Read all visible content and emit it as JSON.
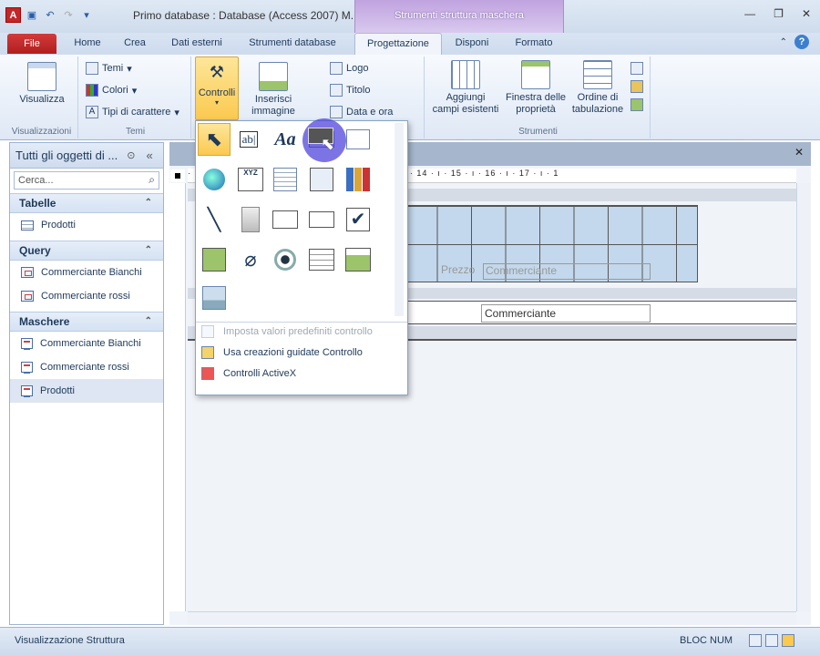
{
  "window": {
    "title": "Primo database : Database (Access 2007) M...",
    "context_tab": "Strumenti struttura maschera"
  },
  "tabs": [
    "File",
    "Home",
    "Crea",
    "Dati esterni",
    "Strumenti database",
    "Progettazione",
    "Disponi",
    "Formato"
  ],
  "ribbon": {
    "visualizza": "Visualizza",
    "visualizzazioni": "Visualizzazioni",
    "temi": "Temi",
    "colori": "Colori",
    "tipi_carattere": "Tipi di carattere",
    "temi_group": "Temi",
    "controlli": "Controlli",
    "inserisci": "Inserisci",
    "immagine": "immagine",
    "logo": "Logo",
    "titolo": "Titolo",
    "data_ora": "Data e ora",
    "intest_partial": "ina",
    "aggiungi": "Aggiungi",
    "campi_esistenti": "campi esistenti",
    "finestra": "Finestra delle",
    "proprieta": "proprietà",
    "ordine": "Ordine di",
    "tabulazione": "tabulazione",
    "strumenti": "Strumenti"
  },
  "nav": {
    "header": "Tutti gli oggetti di ...",
    "search_placeholder": "Cerca...",
    "sections": [
      {
        "title": "Tabelle",
        "items": [
          "Prodotti"
        ]
      },
      {
        "title": "Query",
        "items": [
          "Commerciante Bianchi",
          "Commerciante rossi"
        ]
      },
      {
        "title": "Maschere",
        "items": [
          "Commerciante Bianchi",
          "Commerciante rossi",
          "Prodotti"
        ]
      }
    ]
  },
  "form": {
    "label_prezzo": "Prezzo",
    "label_commerciante": "Commerciante",
    "field_commerciante": "Commerciante",
    "ruler": "· 7 · ı · 8 · ı · 9 · ı · 10 · ı · 11 · ı · 12 · ı · 13 · ı · 14 · ı · 15 · ı · 16 · ı · 17 · ı · 1"
  },
  "gallery_menu": {
    "item1": "Imposta valori predefiniti controllo",
    "item2": "Usa creazioni guidate Controllo",
    "item3": "Controlli ActiveX"
  },
  "status": {
    "left": "Visualizzazione Struttura",
    "right": "BLOC NUM"
  }
}
